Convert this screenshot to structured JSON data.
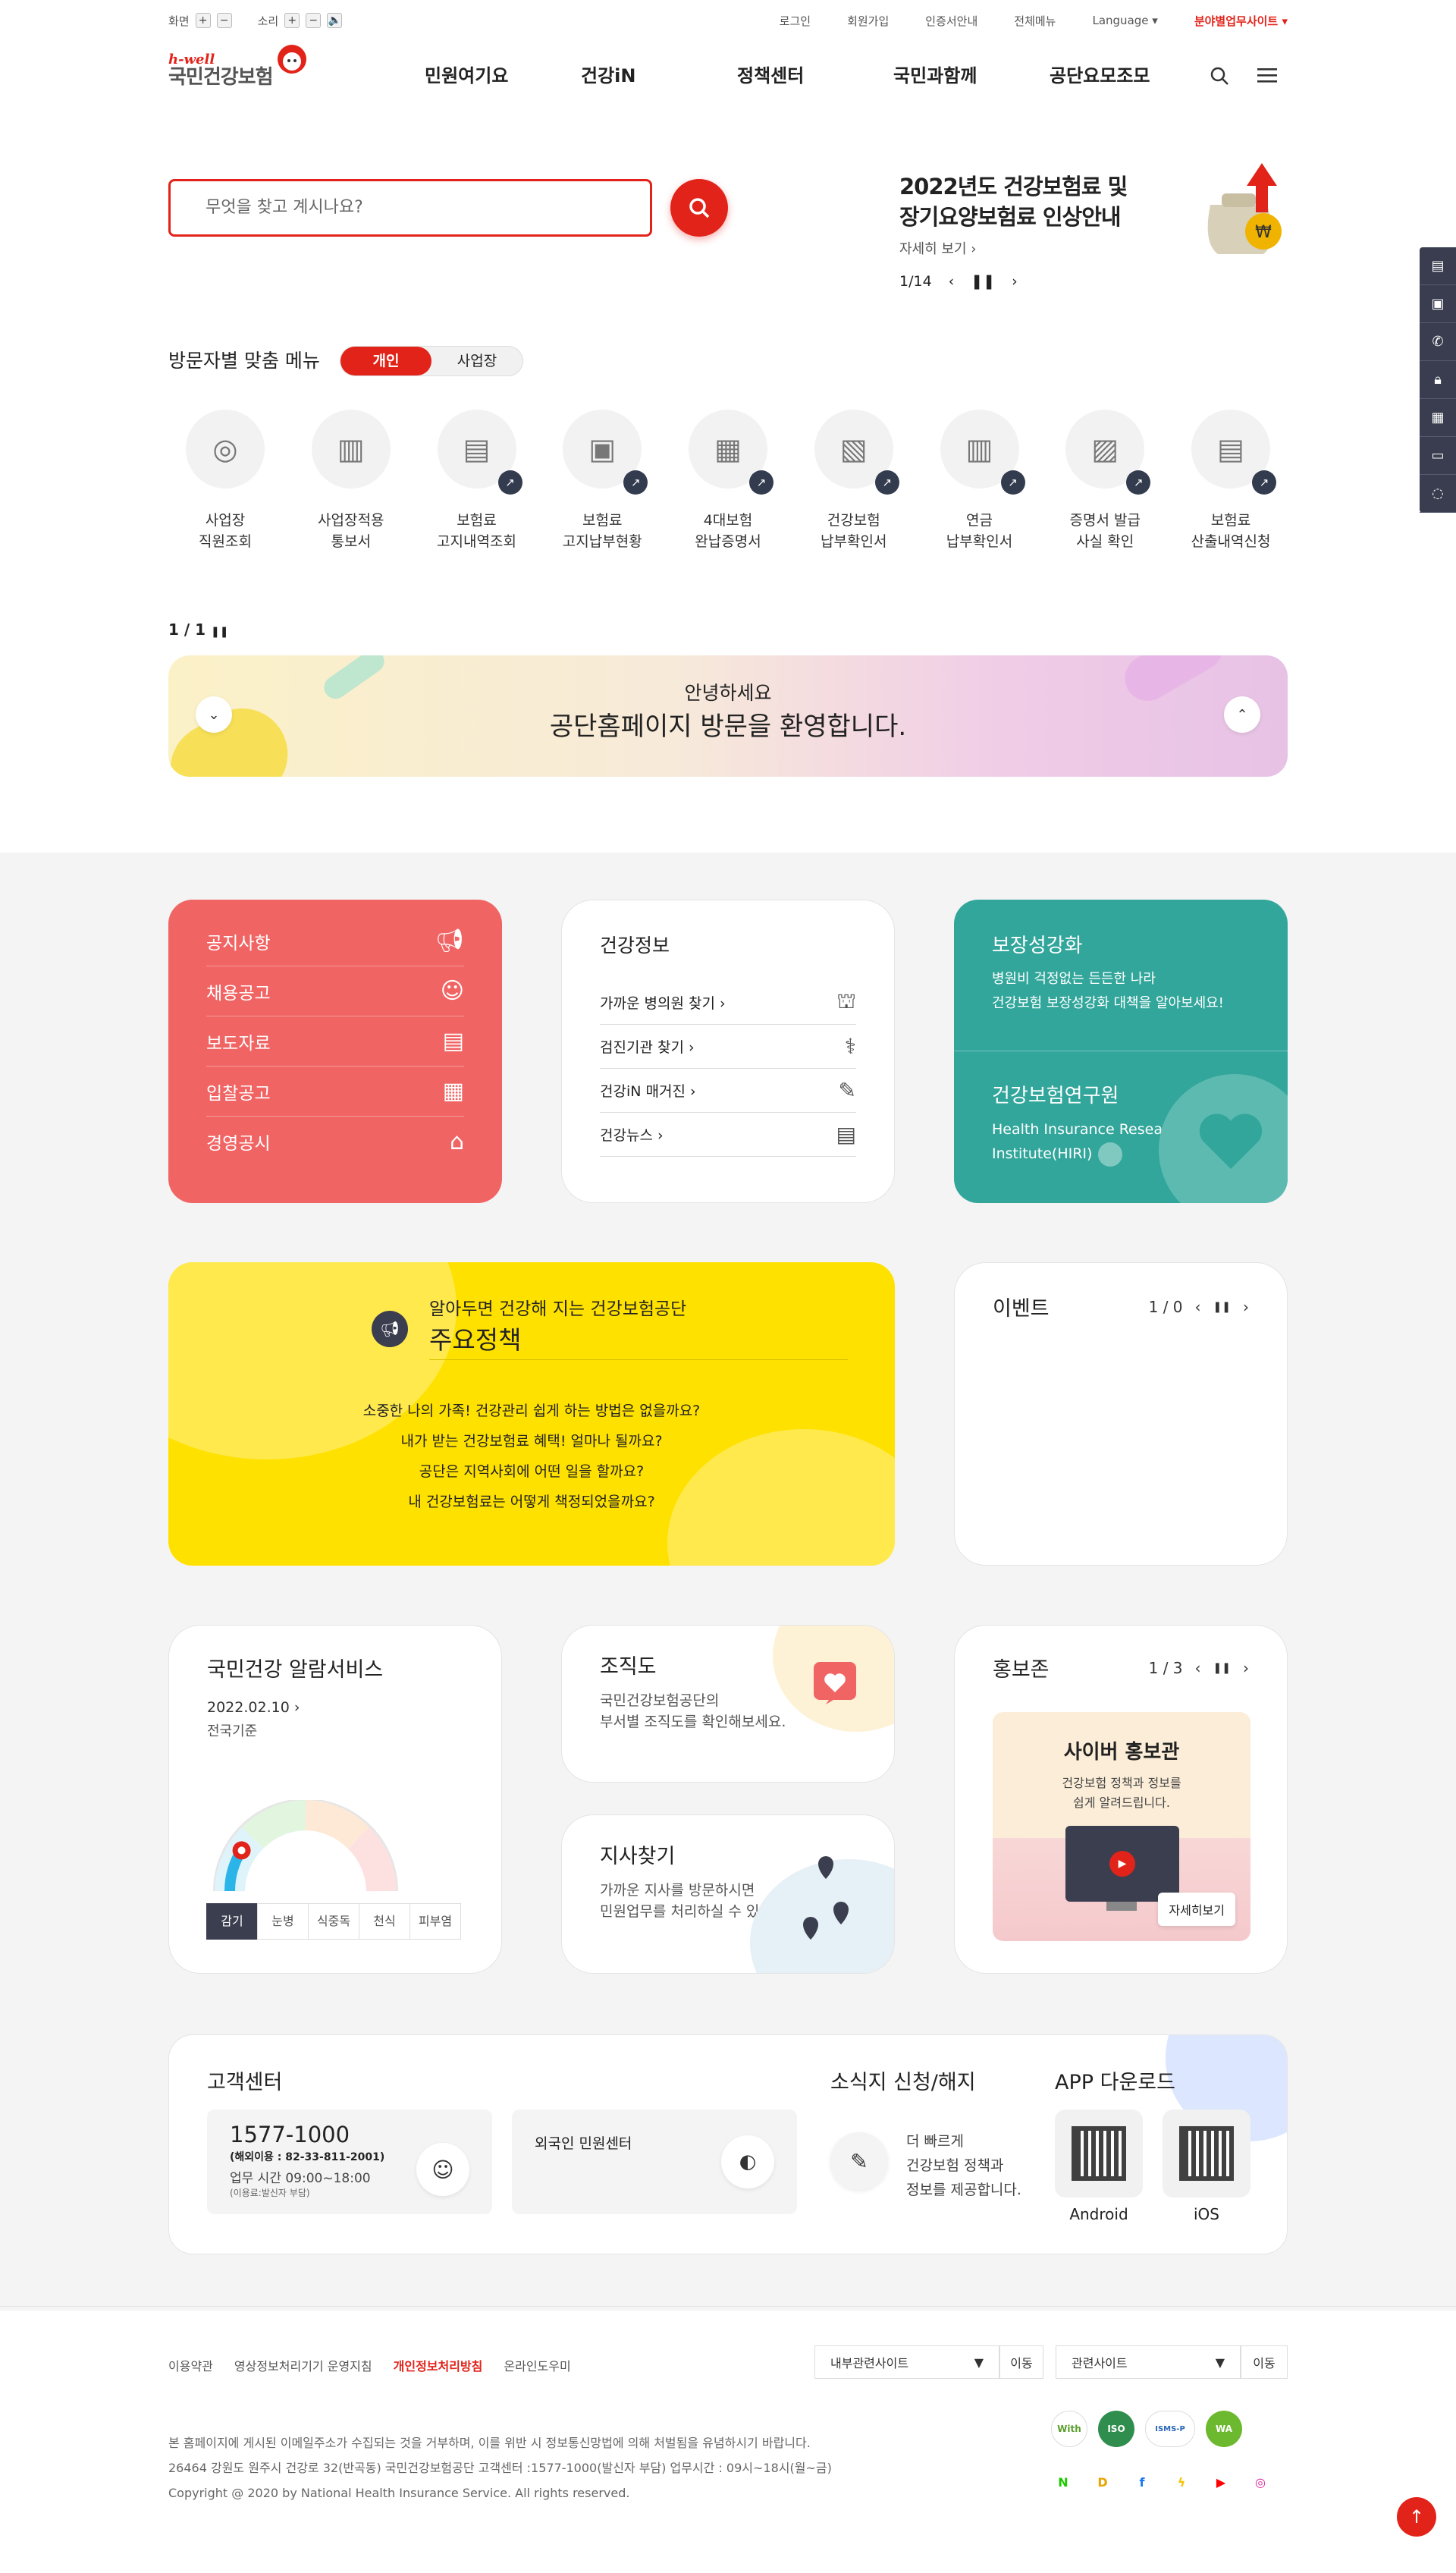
{
  "util": {
    "screen": "화면",
    "sound": "소리",
    "plus": "+",
    "minus": "−",
    "login": "로그인",
    "join": "회원가입",
    "cert": "인증서안내",
    "allmenu": "전체메뉴",
    "language": "Language",
    "bizsite": "분야별업무사이트"
  },
  "logo": {
    "small": "h-well",
    "big": "국민건강보험"
  },
  "gnb": [
    "민원여기요",
    "건강iN",
    "정책센터",
    "국민과함께",
    "공단요모조모"
  ],
  "search": {
    "placeholder": "무엇을 찾고 계시나요?"
  },
  "notice": {
    "title_line1": "2022년도 건강보험료 및",
    "title_line2": "장기요양보험료 인상안내",
    "more": "자세히 보기",
    "pager": "1/14"
  },
  "service": {
    "title": "방문자별 맞춤 메뉴",
    "tab_personal": "개인",
    "tab_business": "사업장",
    "items": [
      {
        "line1": "사업장",
        "line2": "직원조회"
      },
      {
        "line1": "사업장적용",
        "line2": "통보서"
      },
      {
        "line1": "보험료",
        "line2": "고지내역조회"
      },
      {
        "line1": "보험료",
        "line2": "고지납부현황"
      },
      {
        "line1": "4대보험",
        "line2": "완납증명서"
      },
      {
        "line1": "건강보험",
        "line2": "납부확인서"
      },
      {
        "line1": "연금",
        "line2": "납부확인서"
      },
      {
        "line1": "증명서 발급",
        "line2": "사실 확인"
      },
      {
        "line1": "보험료",
        "line2": "산출내역신청"
      }
    ],
    "pager": "1 / 1"
  },
  "banner": {
    "line1": "안녕하세요",
    "line2": "공단홈페이지 방문을 환영합니다."
  },
  "redmenu": [
    "공지사항",
    "채용공고",
    "보도자료",
    "입찰공고",
    "경영공시"
  ],
  "health": {
    "title": "건강정보",
    "items": [
      "가까운 병의원 찾기",
      "검진기관 찾기",
      "건강iN 매거진",
      "건강뉴스"
    ]
  },
  "teal": {
    "title1": "보장성강화",
    "desc1a": "병원비 걱정없는 든든한 나라",
    "desc1b": "건강보험 보장성강화 대책을 알아보세요!",
    "title2": "건강보험연구원",
    "desc2a": "Health Insurance Research",
    "desc2b": "Institute(HIRI)"
  },
  "policy": {
    "sub": "알아두면 건강해 지는 건강보험공단",
    "title": "주요정책",
    "questions": [
      "소중한 나의 가족! 건강관리 쉽게 하는 방법은 없을까요?",
      "내가 받는 건강보험료 혜택! 얼마나 될까요?",
      "공단은 지역사회에 어떤 일을 할까요?",
      "내 건강보험료는 어떻게 책정되었을까요?"
    ]
  },
  "event": {
    "title": "이벤트",
    "pager": "1 / 0"
  },
  "alarm": {
    "title": "국민건강 알람서비스",
    "date": "2022.02.10",
    "basis": "전국기준",
    "level": 0.18,
    "tabs": [
      "감기",
      "눈병",
      "식중독",
      "천식",
      "피부염"
    ]
  },
  "org": {
    "title": "조직도",
    "desc1": "국민건강보험공단의",
    "desc2": "부서별 조직도를 확인해보세요."
  },
  "branch": {
    "title": "지사찾기",
    "desc1": "가까운 지사를 방문하시면",
    "desc2": "민원업무를 처리하실 수 있습니다."
  },
  "promo": {
    "title": "홍보존",
    "pager": "1 / 3",
    "card_title": "사이버 홍보관",
    "card_desc1": "건강보험 정책과 정보를",
    "card_desc2": "쉽게 알려드립니다.",
    "more": "자세히보기"
  },
  "customer": {
    "title": "고객센터",
    "phone": "1577-1000",
    "overseas": "(해외이용 : 82-33-811-2001)",
    "hours": "업무 시간 09:00~18:00",
    "fee": "(이용료:발신자 부담)",
    "foreign": "외국인 민원센터",
    "news_title": "소식지 신청/해지",
    "news1": "더 빠르게",
    "news2": "건강보험 정책과",
    "news3": "정보를 제공합니다.",
    "app_title": "APP 다운로드",
    "android": "Android",
    "ios": "iOS"
  },
  "footer": {
    "links": [
      "이용약관",
      "영상정보처리기기 운영지침",
      "개인정보처리방침",
      "온라인도우미"
    ],
    "select1": "내부관련사이트",
    "select2": "관련사이트",
    "go": "이동",
    "text1": "본 홈페이지에 게시된 이메일주소가 수집되는 것을 거부하며, 이를 위반 시 정보통신망법에 의해 처벌됨을 유념하시기 바랍니다.",
    "text2": "26464 강원도 원주시 건강로 32(반곡동) 국민건강보험공단 고객센터 :1577-1000(발신자 부담) 업무시간 : 09시~18시(월~금)",
    "text3": "Copyright @ 2020 by National Health Insurance Service. All rights reserved.",
    "badge1": "With",
    "badge2": "ISO",
    "badge3": "ISMS-P",
    "badge4": "WA"
  },
  "colors": {
    "brand": "#e2231a",
    "teal": "#32a69b",
    "yellow": "#ffe100",
    "coral": "#f16464",
    "navy": "#3b3e4f"
  }
}
